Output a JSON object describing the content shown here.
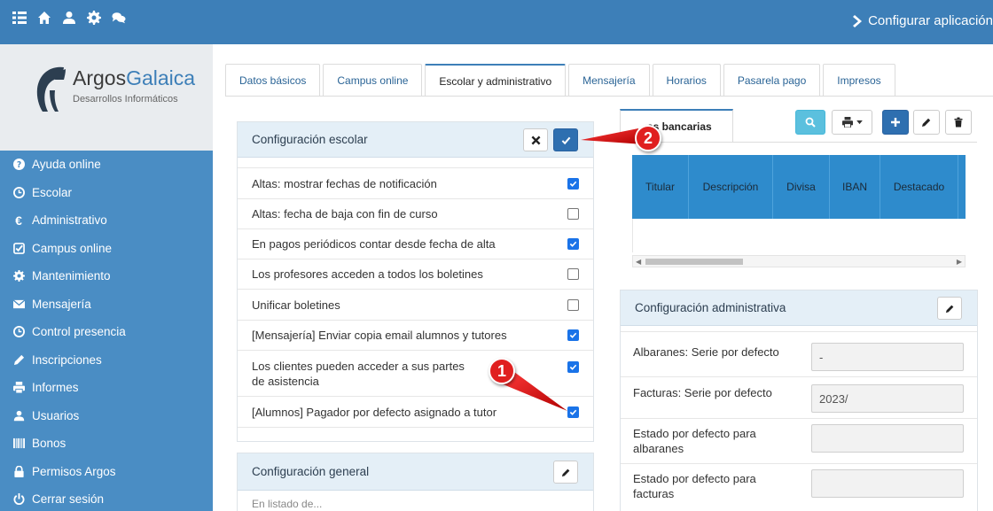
{
  "topbar": {
    "icons": [
      "list-icon",
      "home-icon",
      "user-icon",
      "gear-icon",
      "chat-icon"
    ],
    "config_label": "Configurar aplicación"
  },
  "logo": {
    "brand_part1": "Argos",
    "brand_part2": "Galaica",
    "subtitle": "Desarrollos Informáticos"
  },
  "sidebar": {
    "items": [
      {
        "label": "Ayuda online",
        "icon": "question-icon"
      },
      {
        "label": "Escolar",
        "icon": "clock-icon"
      },
      {
        "label": "Administrativo",
        "icon": "euro-icon"
      },
      {
        "label": "Campus online",
        "icon": "check-square-icon"
      },
      {
        "label": "Mantenimiento",
        "icon": "gear-icon"
      },
      {
        "label": "Mensajería",
        "icon": "envelope-icon"
      },
      {
        "label": "Control presencia",
        "icon": "clock-icon"
      },
      {
        "label": "Inscripciones",
        "icon": "pencil-icon"
      },
      {
        "label": "Informes",
        "icon": "print-icon"
      },
      {
        "label": "Usuarios",
        "icon": "user-icon"
      },
      {
        "label": "Bonos",
        "icon": "barcode-icon"
      },
      {
        "label": "Permisos Argos",
        "icon": "lock-icon"
      },
      {
        "label": "Cerrar sesión",
        "icon": "power-icon"
      }
    ]
  },
  "tabs": [
    {
      "label": "Datos básicos",
      "active": false
    },
    {
      "label": "Campus online",
      "active": false
    },
    {
      "label": "Escolar y administrativo",
      "active": true
    },
    {
      "label": "Mensajería",
      "active": false
    },
    {
      "label": "Horarios",
      "active": false
    },
    {
      "label": "Pasarela pago",
      "active": false
    },
    {
      "label": "Impresos",
      "active": false
    }
  ],
  "escolar": {
    "title": "Configuración escolar",
    "options": [
      {
        "label": "Altas: mostrar fechas de notificación",
        "checked": true
      },
      {
        "label": "Altas: fecha de baja con fin de curso",
        "checked": false
      },
      {
        "label": "En pagos periódicos contar desde fecha de alta",
        "checked": true
      },
      {
        "label": "Los profesores acceden a todos los boletines",
        "checked": false
      },
      {
        "label": "Unificar boletines",
        "checked": false
      },
      {
        "label": "[Mensajería] Enviar copia email alumnos y tutores",
        "checked": true
      },
      {
        "label": "Los clientes pueden acceder a sus partes de asistencia",
        "checked": true
      },
      {
        "label": "[Alumnos] Pagador por defecto asignado a tutor",
        "checked": true
      }
    ]
  },
  "general": {
    "title": "Configuración general",
    "partial_row": "En listado de..."
  },
  "bank": {
    "tab_label": "as bancarias",
    "columns": [
      "Titular",
      "Descripción",
      "Divisa",
      "IBAN",
      "Destacado"
    ]
  },
  "admin": {
    "title": "Configuración administrativa",
    "fields": [
      {
        "label": "Albaranes: Serie por defecto",
        "value": "-"
      },
      {
        "label": "Facturas: Serie por defecto",
        "value": "2023/"
      },
      {
        "label": "Estado por defecto para albaranes",
        "value": ""
      },
      {
        "label": "Estado por defecto para facturas",
        "value": ""
      }
    ]
  },
  "callouts": {
    "one": "1",
    "two": "2"
  },
  "colors": {
    "topbar": "#3d7fb8",
    "sidebar": "#4a8dc4",
    "accent": "#2e6fb0",
    "callout": "#e02020"
  }
}
